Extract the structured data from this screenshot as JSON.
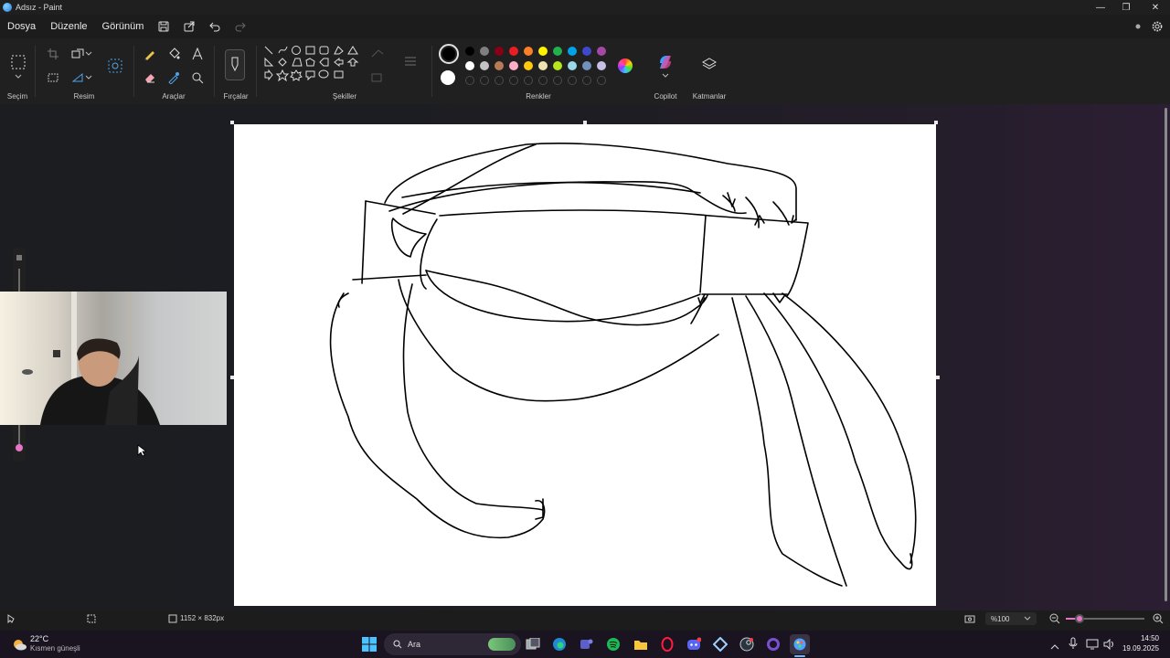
{
  "window": {
    "title": "Adsız - Paint"
  },
  "menu": {
    "file": "Dosya",
    "edit": "Düzenle",
    "view": "Görünüm"
  },
  "ribbon": {
    "groups": {
      "selection": "Seçim",
      "image": "Resim",
      "tools": "Araçlar",
      "brushes": "Fırçalar",
      "shapes": "Şekiller",
      "colors": "Renkler",
      "copilot": "Copilot",
      "layers": "Katmanlar"
    },
    "palette_row1": [
      "#000000",
      "#7f7f7f",
      "#880015",
      "#ed1c24",
      "#ff7f27",
      "#fff200",
      "#22b14c",
      "#00a2e8",
      "#3f48cc",
      "#a349a4"
    ],
    "palette_row2": [
      "#ffffff",
      "#c3c3c3",
      "#b97a57",
      "#ffaec9",
      "#ffc90e",
      "#efe4b0",
      "#b5e61d",
      "#99d9ea",
      "#7092be",
      "#c8bfe7"
    ],
    "primary_color": "#000000",
    "secondary_color": "#ffffff"
  },
  "status": {
    "canvas_size": "1152 × 832px",
    "zoom": "%100"
  },
  "taskbar": {
    "weather_temp": "22°C",
    "weather_desc": "Kısmen güneşli",
    "search_label": "Ara",
    "time": "14:50",
    "date": "19.09.2025"
  }
}
